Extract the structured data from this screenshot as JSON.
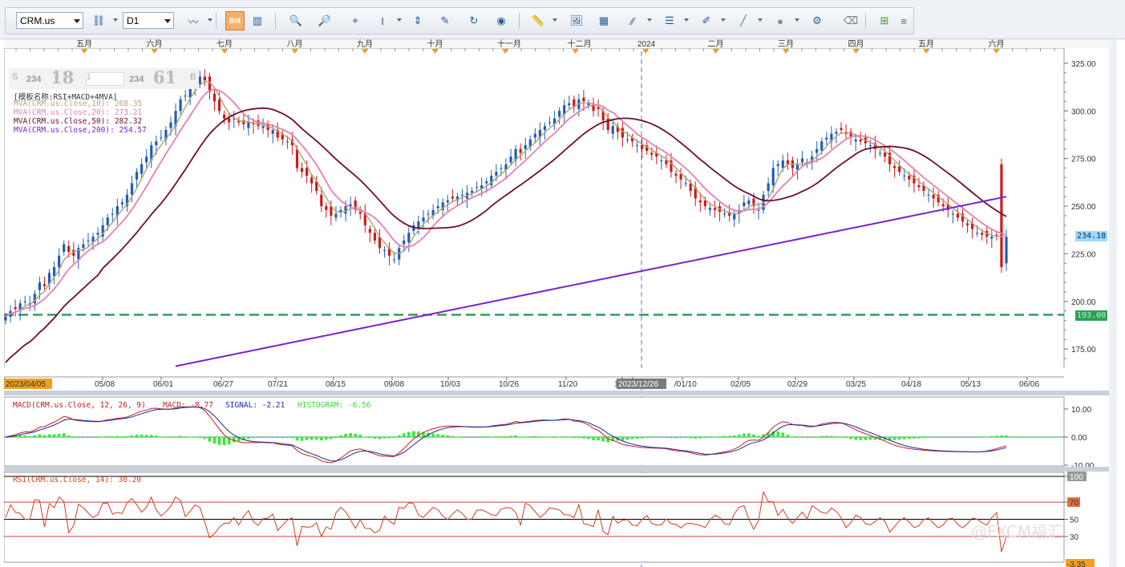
{
  "toolbar": {
    "symbol": "CRM.us",
    "timeframe": "D1",
    "active_button_label": "BM",
    "buttons": [
      "chart-type-icon",
      "bar-chart-icon",
      "candlestick-icon",
      "zoom-in-icon",
      "zoom-out-icon",
      "indicator-icon",
      "crosshair-icon",
      "properties-icon",
      "refresh-icon",
      "globe-icon",
      "ruler-icon",
      "image-icon",
      "template-icon",
      "lines-icon",
      "menu-icon",
      "pen-icon",
      "line-icon",
      "circle-icon",
      "alert-icon",
      "eraser-icon",
      "tree-icon"
    ]
  },
  "price_panel": {
    "info_box": {
      "s_label": "S",
      "s_small": "234",
      "s_big": "18",
      "mid": "1",
      "b_small": "234",
      "b_big": "61",
      "b_label": "B"
    },
    "template_label": "[模板名称:RSI+MACD+4MVA]",
    "mva_labels": [
      {
        "text": "MVA(CRM.us.Close,10): 268.35",
        "color": "#b5a57a"
      },
      {
        "text": "MVA(CRM.us.Close,20): 273.21",
        "color": "#e77fb3"
      },
      {
        "text": "MVA(CRM.us.Close,50): 282.32",
        "color": "#6b0f2a"
      },
      {
        "text": "MVA(CRM.us.Close,200): 254.57",
        "color": "#7a22cc"
      }
    ],
    "y_ticks": [
      "325.00",
      "300.00",
      "275.00",
      "250.00",
      "225.00",
      "200.00",
      "175.00"
    ],
    "price_tag": "234.18",
    "dashed_level_tag": "193.00",
    "months_top": [
      "五月",
      "六月",
      "七月",
      "八月",
      "九月",
      "十月",
      "十一月",
      "十二月",
      "2024",
      "二月",
      "三月",
      "四月",
      "五月",
      "六月"
    ],
    "x_dates": [
      "2023/04/05",
      "05/08",
      "06/01",
      "06/27",
      "07/21",
      "08/15",
      "09/08",
      "10/03",
      "10/26",
      "11/20",
      "12",
      "2023/12/26",
      "/01/10",
      "02/05",
      "02/29",
      "03/25",
      "04/18",
      "05/13",
      "06/06"
    ]
  },
  "macd_panel": {
    "label_title": "MACD(CRM.us.Close, 12, 26, 9)",
    "label_macd": "MACD: -8.77",
    "label_signal": "SIGNAL: -2.21",
    "label_hist": "HISTOGRAM: -6.56",
    "y_ticks": [
      "10.00",
      "0.00",
      "-10.00"
    ]
  },
  "rsi_panel": {
    "label": "RSI(CRM.us.Close, 14): 30.20",
    "y_ticks": [
      "100",
      "70",
      "50",
      "30"
    ],
    "value_tag": "-3.35"
  },
  "watermark": "@FXCM福汇",
  "chart_data": {
    "type": "candlestick",
    "symbol": "CRM.us",
    "closes_approx": [
      192,
      195,
      196,
      199,
      200,
      199,
      204,
      210,
      208,
      215,
      218,
      224,
      230,
      226,
      224,
      228,
      230,
      232,
      234,
      236,
      240,
      244,
      246,
      250,
      252,
      256,
      262,
      268,
      272,
      276,
      282,
      284,
      286,
      290,
      294,
      300,
      306,
      308,
      312,
      316,
      318,
      316,
      310,
      305,
      300,
      296,
      294,
      296,
      294,
      293,
      294,
      293,
      292,
      292,
      290,
      290,
      286,
      285,
      284,
      282,
      270,
      268,
      266,
      262,
      258,
      250,
      248,
      245,
      246,
      248,
      250,
      251,
      248,
      246,
      240,
      236,
      232,
      228,
      227,
      224,
      222,
      228,
      232,
      236,
      240,
      242,
      244,
      246,
      248,
      250,
      252,
      253,
      254,
      255,
      256,
      257,
      258,
      260,
      261,
      263,
      266,
      268,
      270,
      272,
      276,
      280,
      278,
      282,
      285,
      288,
      290,
      292,
      294,
      296,
      300,
      303,
      304,
      302,
      306,
      305,
      304,
      300,
      301,
      295,
      290,
      292,
      289,
      286,
      285,
      284,
      282,
      280,
      279,
      277,
      276,
      274,
      272,
      268,
      266,
      264,
      262,
      258,
      254,
      252,
      250,
      249,
      248,
      247,
      246,
      245,
      246,
      248,
      252,
      253,
      250,
      248,
      256,
      262,
      270,
      272,
      274,
      272,
      270,
      272,
      275,
      273,
      276,
      280,
      284,
      286,
      288,
      289,
      290,
      288,
      286,
      285,
      284,
      283,
      282,
      280,
      278,
      276,
      272,
      270,
      268,
      266,
      264,
      262,
      260,
      258,
      256,
      254,
      252,
      250,
      248,
      246,
      244,
      242,
      240,
      238,
      236,
      235,
      234,
      234,
      234,
      234,
      234
    ],
    "ylim": [
      165,
      330
    ],
    "y_ticks": [
      175,
      200,
      225,
      250,
      275,
      300,
      325
    ],
    "dashed_level": 193,
    "last_price": 234.18
  }
}
